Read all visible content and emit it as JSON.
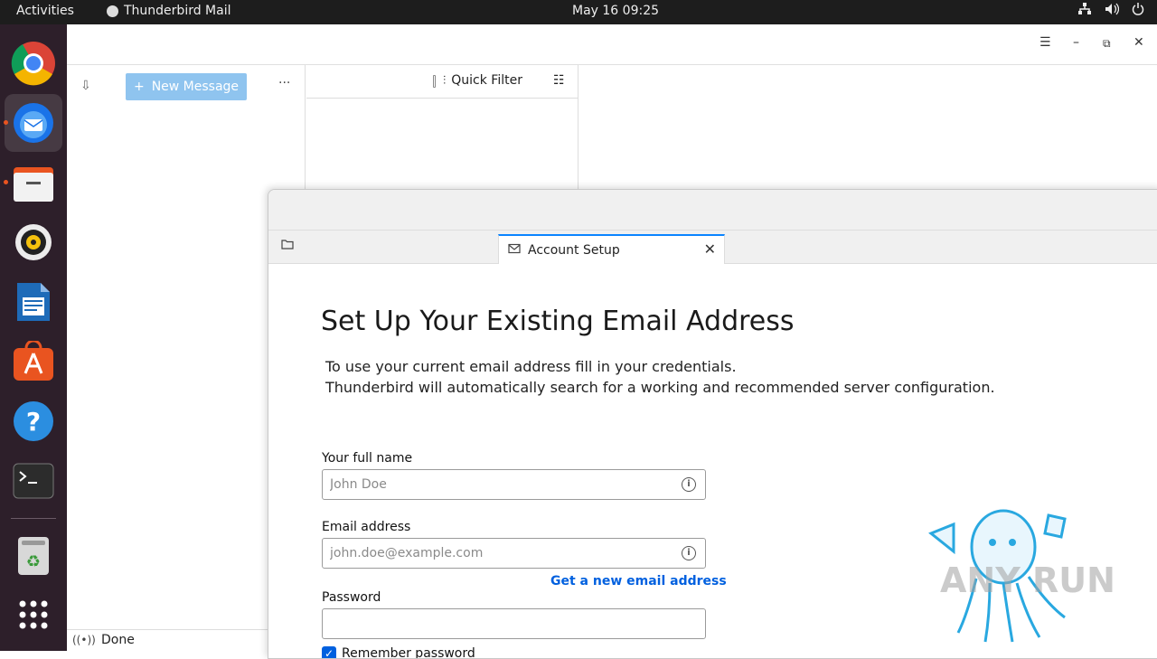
{
  "topbar": {
    "activities": "Activities",
    "app_name": "Thunderbird Mail",
    "clock": "May 16  09:25"
  },
  "dock": {
    "items": [
      "chrome-icon",
      "thunderbird-icon",
      "files-icon",
      "rhythmbox-icon",
      "writer-icon",
      "app-center-icon",
      "help-icon",
      "terminal-icon",
      "trash-icon",
      "apps-grid-icon"
    ]
  },
  "mail": {
    "new_message": "New Message",
    "quick_filter": "Quick Filter",
    "status": "Done"
  },
  "dialog": {
    "tab_label": "Account Setup",
    "heading": "Set Up Your Existing Email Address",
    "desc_line1": "To use your current email address fill in your credentials.",
    "desc_line2": "Thunderbird will automatically search for a working and recommended server configuration.",
    "name_label": "Your full name",
    "name_placeholder": "John Doe",
    "email_label": "Email address",
    "email_placeholder": "john.doe@example.com",
    "get_new_email": "Get a new email address",
    "password_label": "Password",
    "remember_password": "Remember password"
  },
  "watermark": {
    "text": "ANY RUN"
  },
  "colors": {
    "accent": "#0060df",
    "dock_bg": "#2d1f2a",
    "new_message_btn": "#8fc4ef"
  }
}
